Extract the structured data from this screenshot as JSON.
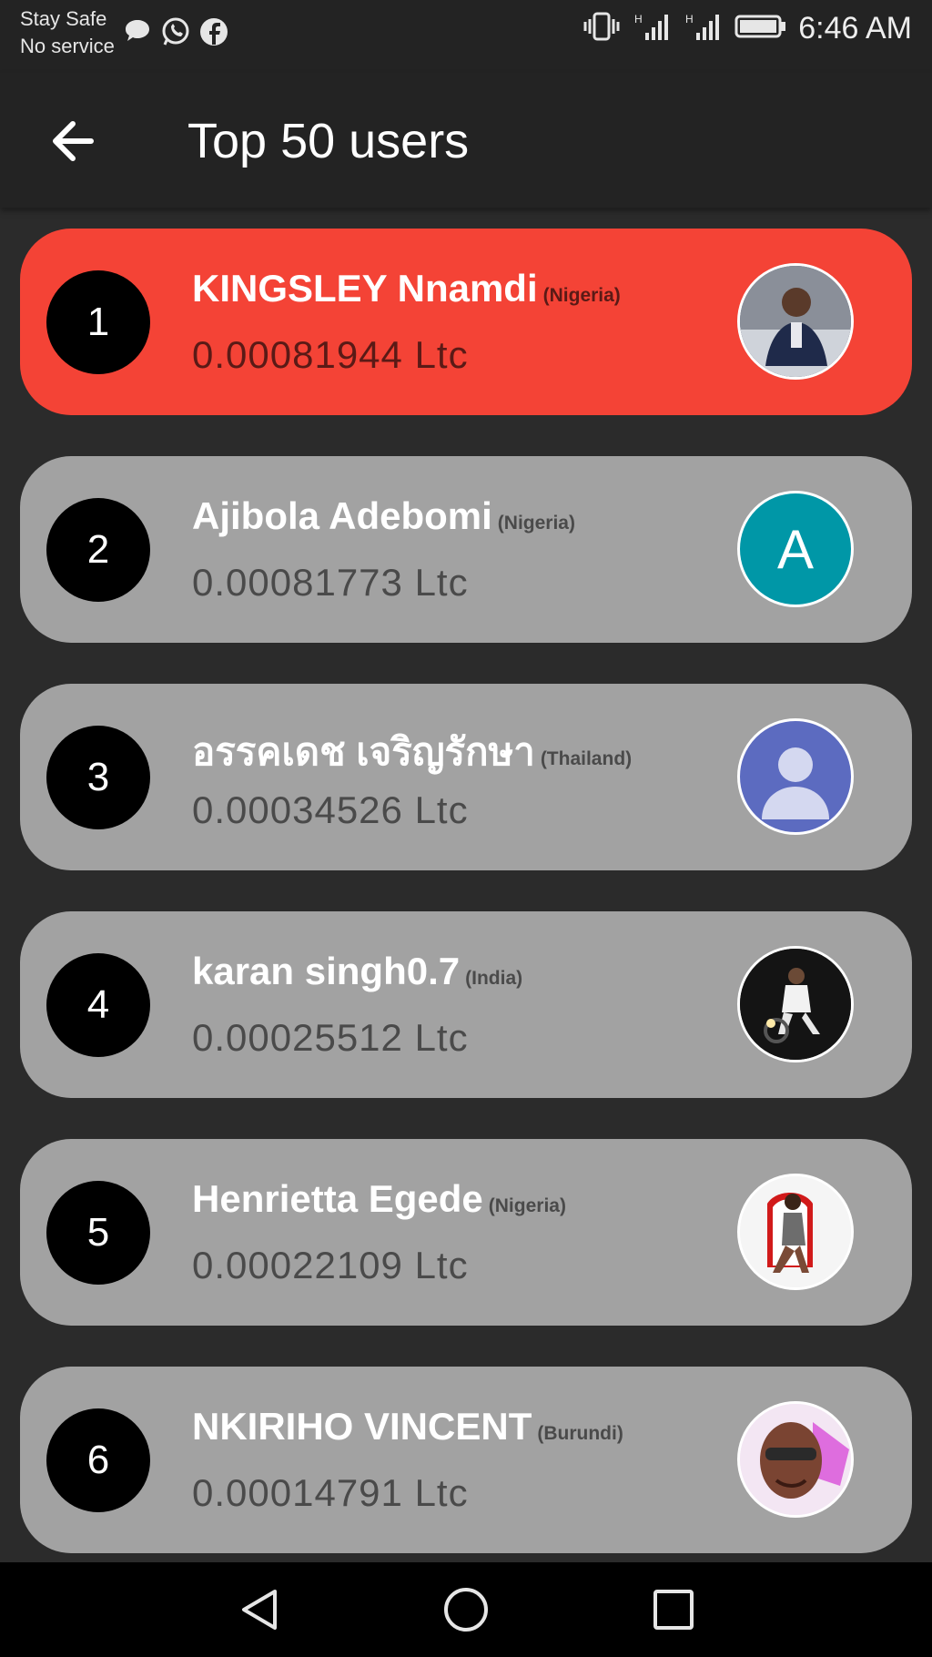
{
  "status_bar": {
    "carrier_line1": "Stay Safe",
    "carrier_line2": "No service",
    "notification_icons": [
      "chat-bubble-icon",
      "whatsapp-icon",
      "facebook-icon"
    ],
    "system_icons": [
      "vibrate-icon",
      "signal-h-icon",
      "signal-h-icon",
      "battery-icon"
    ],
    "time": "6:46 AM"
  },
  "app_bar": {
    "title": "Top 50 users",
    "back_icon": "arrow-left-icon"
  },
  "users": [
    {
      "rank": "1",
      "name": "KINGSLEY Nnamdi",
      "country": "(Nigeria)",
      "amount": "0.00081944  Ltc",
      "avatar": "photo",
      "highlight": "#f44336"
    },
    {
      "rank": "2",
      "name": "Ajibola Adebomi",
      "country": "(Nigeria)",
      "amount": "0.00081773  Ltc",
      "avatar": "A",
      "avatar_color": "#0097a7"
    },
    {
      "rank": "3",
      "name": "อรรคเดช เจริญรักษา",
      "country": "(Thailand)",
      "amount": "0.00034526  Ltc",
      "avatar": "default-person",
      "avatar_color": "#5c6bc0"
    },
    {
      "rank": "4",
      "name": "karan singh0.7",
      "country": "(India)",
      "amount": "0.00025512  Ltc",
      "avatar": "photo"
    },
    {
      "rank": "5",
      "name": "Henrietta Egede",
      "country": "(Nigeria)",
      "amount": "0.00022109  Ltc",
      "avatar": "photo"
    },
    {
      "rank": "6",
      "name": "NKIRIHO VINCENT",
      "country": "(Burundi)",
      "amount": "0.00014791  Ltc",
      "avatar": "photo"
    }
  ],
  "colors": {
    "background": "#2b2b2b",
    "app_bar": "#232323",
    "card": "#a2a2a2",
    "highlight": "#f44336"
  },
  "nav_bar": {
    "buttons": [
      "back-triangle-icon",
      "home-circle-icon",
      "recents-square-icon"
    ]
  }
}
